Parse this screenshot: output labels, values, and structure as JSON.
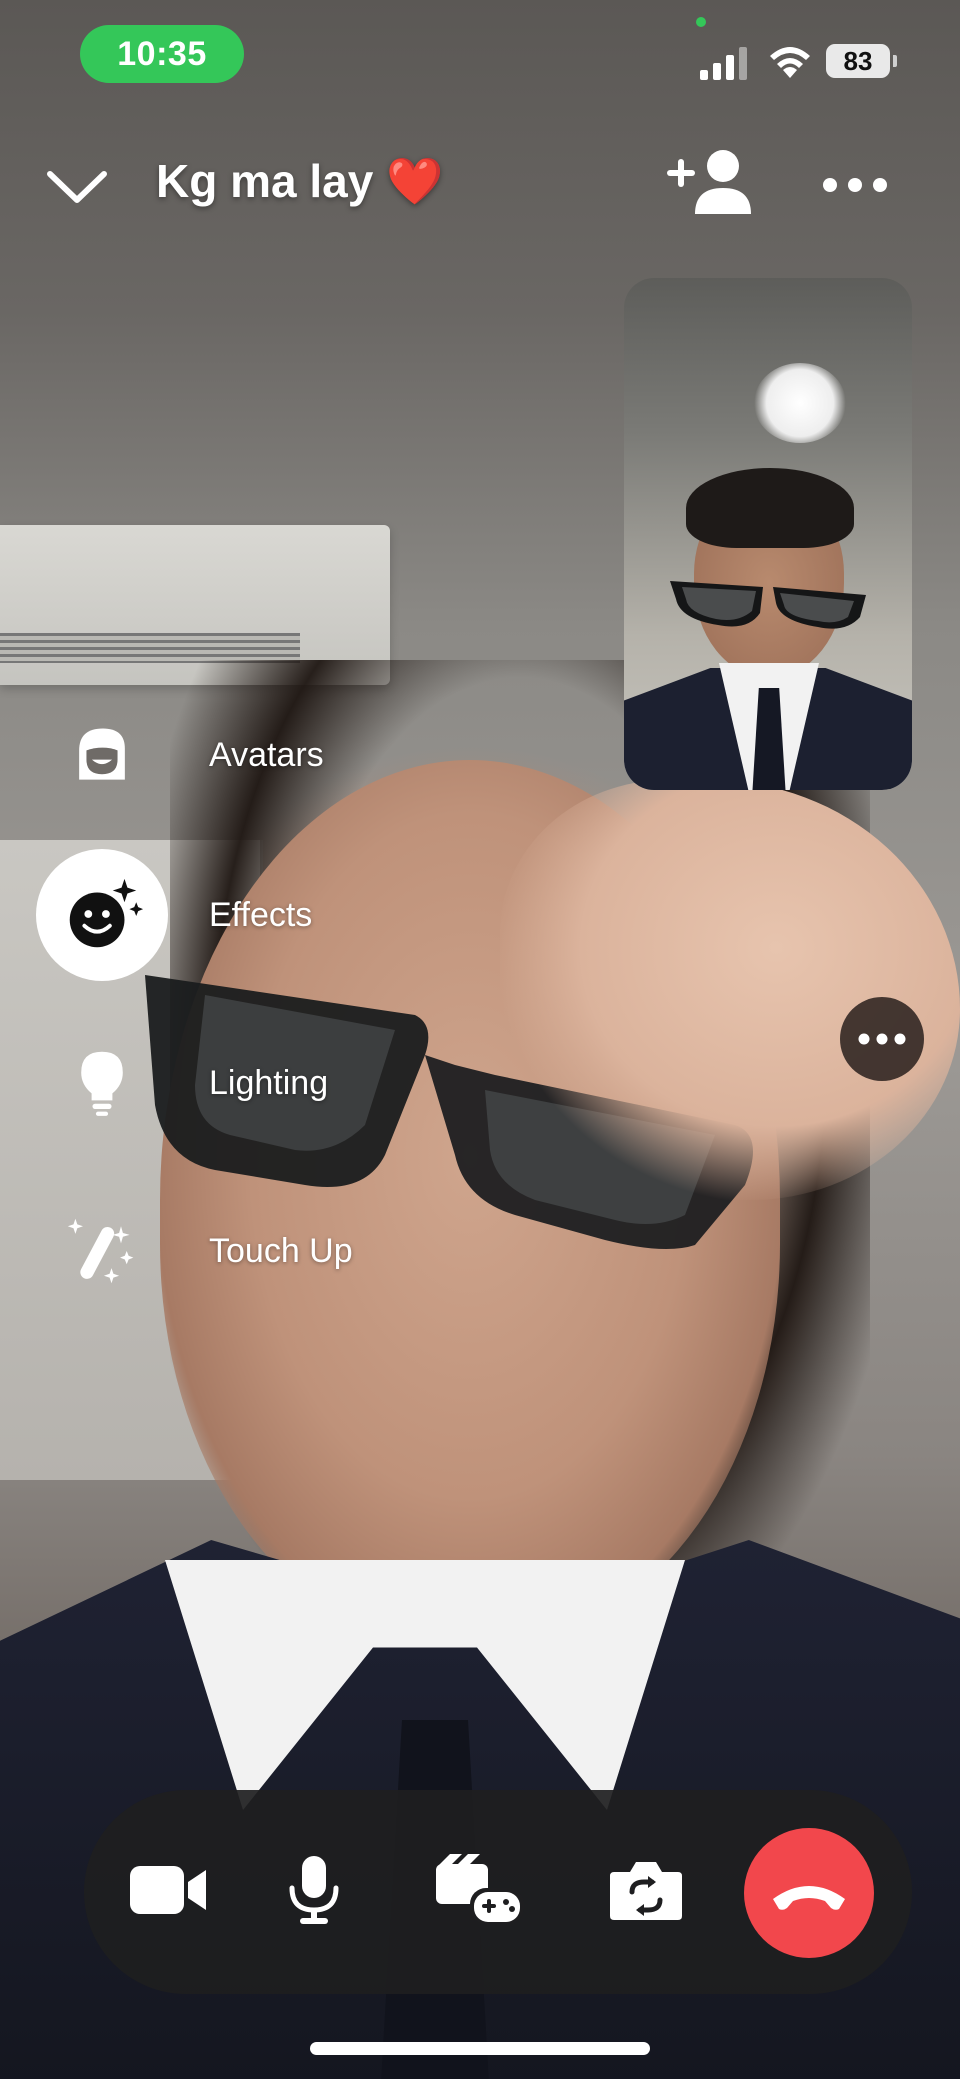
{
  "status_bar": {
    "time": "10:35",
    "battery": "83",
    "icons": [
      "signal-icon",
      "wifi-icon",
      "battery-icon"
    ]
  },
  "header": {
    "title": "Kg ma lay ❤️",
    "icons": [
      "chevron-down-icon",
      "add-person-icon",
      "more-icon"
    ]
  },
  "effects_menu": {
    "items": [
      {
        "label": "Avatars",
        "icon": "avatar-icon",
        "selected": false
      },
      {
        "label": "Effects",
        "icon": "effects-smile-icon",
        "selected": true
      },
      {
        "label": "Lighting",
        "icon": "lightbulb-icon",
        "selected": false
      },
      {
        "label": "Touch Up",
        "icon": "magic-wand-icon",
        "selected": false
      }
    ]
  },
  "controls": {
    "buttons": [
      "video-camera-icon",
      "microphone-icon",
      "games-icon",
      "flip-camera-icon",
      "end-call-icon"
    ],
    "end_call_color": "#f2474c"
  },
  "colors": {
    "time_pill": "#34c759",
    "controls_bg": "#1e1e20"
  }
}
